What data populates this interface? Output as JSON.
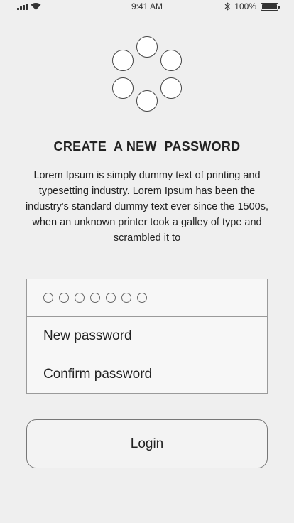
{
  "status_bar": {
    "time": "9:41 AM",
    "battery_text": "100%",
    "battery_level": 1.0,
    "icons": [
      "signal-icon",
      "wifi-icon",
      "bluetooth-icon",
      "battery-icon"
    ]
  },
  "loader": {
    "icon": "loading-spinner-icon",
    "dots": 6
  },
  "title": "CREATE  A NEW  PASSWORD",
  "description": "Lorem Ipsum is simply dummy text of printing and typesetting industry. Lorem Ipsum has been the industry's standard dummy text ever since the 1500s, when an unknown printer took a galley of type and scrambled it to",
  "form": {
    "pin_length": 7,
    "new_password_placeholder": "New password",
    "confirm_password_placeholder": "Confirm password"
  },
  "login_label": "Login"
}
